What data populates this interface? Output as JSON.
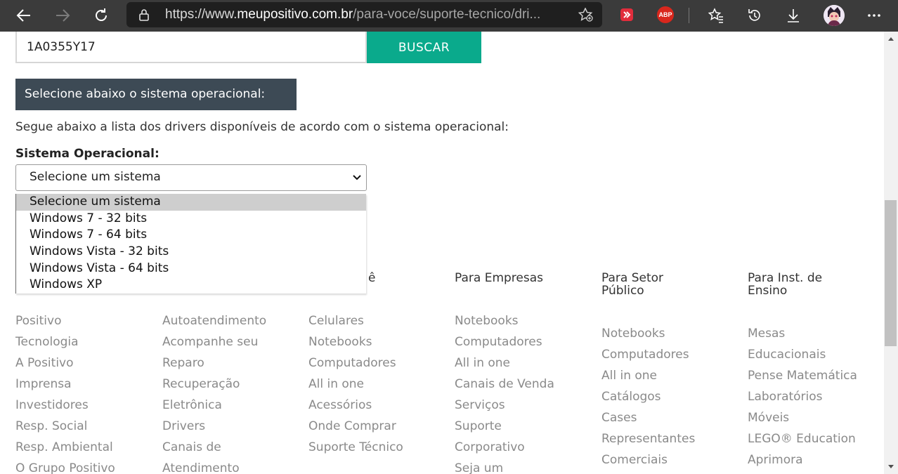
{
  "browser": {
    "url_prefix": "https://www.",
    "url_host": "meupositivo.com.br",
    "url_path": "/para-voce/suporte-tecnico/dri..."
  },
  "search": {
    "value": "1A0355Y17",
    "button_label": "BUSCAR"
  },
  "os_banner": "Selecione abaixo o sistema operacional:",
  "description": "Segue abaixo a lista dos drivers disponíveis de acordo com o sistema operacional:",
  "os_select": {
    "label": "Sistema Operacional:",
    "selected": "Selecione um sistema",
    "options": [
      "Selecione um sistema",
      "Windows 7 - 32 bits",
      "Windows 7 - 64 bits",
      "Windows Vista - 32 bits",
      "Windows Vista - 64 bits",
      "Windows XP"
    ]
  },
  "footer": {
    "col3_head_tail": "ê",
    "col4_head": "Para Empresas",
    "col5_head": "Para Setor Público",
    "col6_head": "Para Inst. de Ensino",
    "col1": [
      "Positivo",
      "Tecnologia",
      "A Positivo",
      "Imprensa",
      "Investidores",
      "Resp. Social",
      "Resp. Ambiental",
      "O Grupo Positivo"
    ],
    "col2": [
      "Autoatendimento",
      "Acompanhe seu",
      "Reparo",
      "Recuperação",
      "Eletrônica",
      "Drivers",
      "Canais de",
      "Atendimento"
    ],
    "col3": [
      "Celulares",
      "Notebooks",
      "Computadores",
      "All in one",
      "Acessórios",
      "Onde Comprar",
      "Suporte Técnico"
    ],
    "col4": [
      "Notebooks",
      "Computadores",
      "All in one",
      "Canais de Venda",
      "Serviços",
      "Suporte",
      "Corporativo",
      "Seja um"
    ],
    "col5": [
      "Notebooks",
      "Computadores",
      "All in one",
      "Catálogos",
      "Cases",
      "Representantes",
      "Comerciais"
    ],
    "col6": [
      "Mesas",
      "Educacionais",
      "Pense Matemática",
      "Laboratórios",
      "Móveis",
      "LEGO® Education",
      "Aprimora"
    ]
  }
}
